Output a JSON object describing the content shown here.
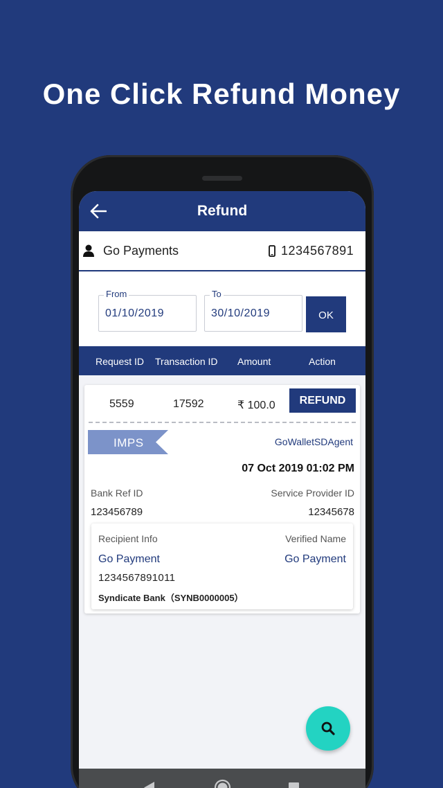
{
  "promo": {
    "title": "One Click Refund Money"
  },
  "appbar": {
    "title": "Refund"
  },
  "merchant": {
    "name": "Go Payments",
    "mobile": "1234567891"
  },
  "filter": {
    "from_label": "From",
    "from_value": "01/10/2019",
    "to_label": "To",
    "to_value": "30/10/2019",
    "ok_label": "OK"
  },
  "table": {
    "headers": [
      "Request ID",
      "Transaction ID",
      "Amount",
      "Action"
    ],
    "row": {
      "request_id": "5559",
      "transaction_id": "17592",
      "amount": "₹ 100.0",
      "action": "REFUND"
    }
  },
  "detail": {
    "mode": "IMPS",
    "agent": "GoWalletSDAgent",
    "datetime": "07 Oct 2019 01:02 PM",
    "bank_ref_label": "Bank Ref ID",
    "bank_ref_value": "123456789",
    "sp_id_label": "Service Provider ID",
    "sp_id_value": "12345678",
    "recipient_label": "Recipient Info",
    "recipient_name": "Go Payment",
    "verified_label": "Verified Name",
    "verified_name": "Go Payment",
    "account_number": "1234567891011",
    "bank": "Syndicate Bank（SYNB0000005）"
  },
  "colors": {
    "primary": "#213a7c",
    "accent": "#23d3c2"
  },
  "icons": {
    "back": "arrow-left-icon",
    "user": "user-icon",
    "mobile": "mobile-phone-icon",
    "fab": "search-icon",
    "nav": [
      "nav-back-icon",
      "nav-home-icon",
      "nav-recents-icon"
    ]
  }
}
